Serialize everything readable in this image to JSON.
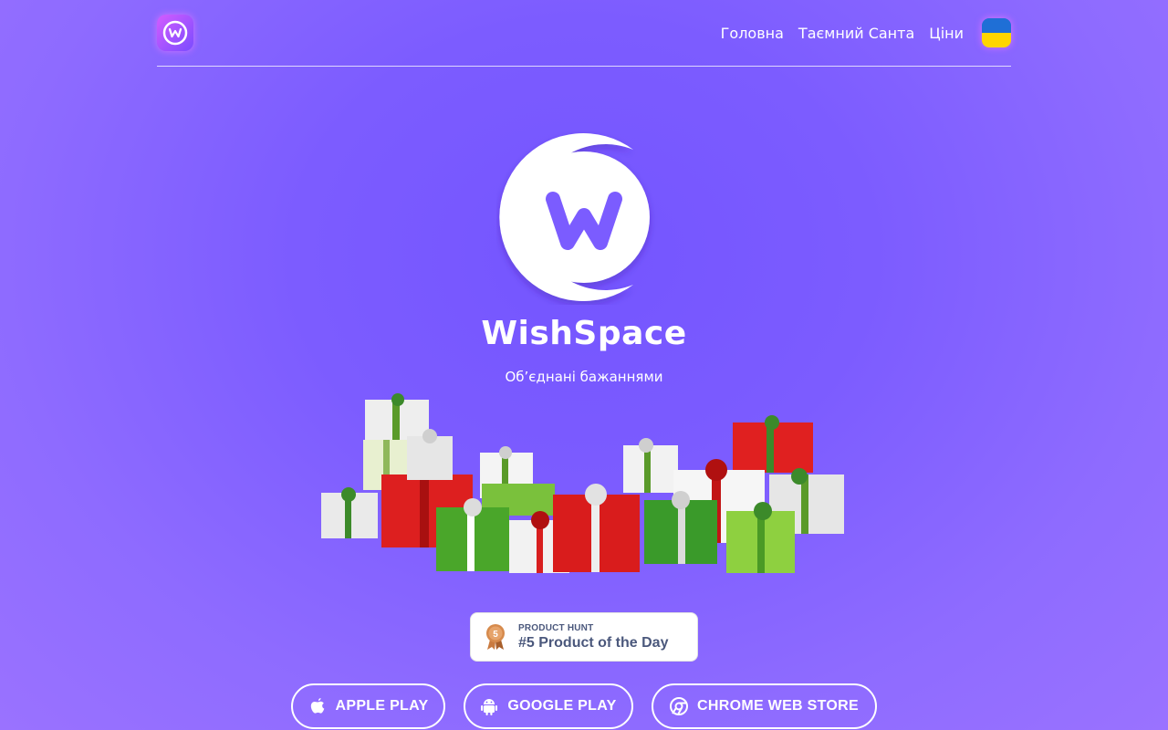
{
  "header": {
    "logo_letter": "W",
    "nav": [
      {
        "label": "Головна"
      },
      {
        "label": "Таємний Санта"
      },
      {
        "label": "Ціни"
      }
    ],
    "language_flag": "ukraine-flag"
  },
  "hero": {
    "brand_name": "WishSpace",
    "tagline": "Обʼєднані бажаннями"
  },
  "product_hunt": {
    "label": "PRODUCT HUNT",
    "title": "#5 Product of the Day",
    "rank": "5"
  },
  "stores": [
    {
      "label": "APPLE PLAY",
      "icon": "apple-icon"
    },
    {
      "label": "GOOGLE PLAY",
      "icon": "android-icon"
    },
    {
      "label": "CHROME WEB STORE",
      "icon": "chrome-icon"
    }
  ],
  "colors": {
    "background": "#7c5cff",
    "accent": "#ffffff",
    "flag_blue": "#1f6fd6",
    "flag_yellow": "#ffd500",
    "ph_text": "#4b587c"
  }
}
